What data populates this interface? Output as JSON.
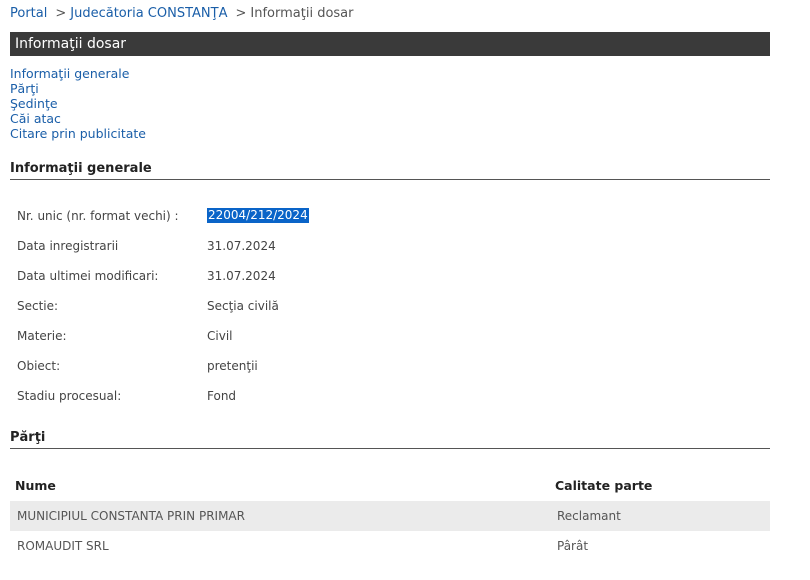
{
  "breadcrumb": {
    "items": [
      "Portal",
      "Judecătoria CONSTANŢA",
      "Informaţii dosar"
    ],
    "separator": ">"
  },
  "title": "Informaţii dosar",
  "nav": {
    "links": [
      "Informaţii generale",
      "Părţi",
      "Şedinţe",
      "Căi atac",
      "Citare prin publicitate"
    ]
  },
  "general": {
    "heading": "Informaţii generale",
    "rows": [
      {
        "label": "Nr. unic (nr. format vechi) :",
        "value": "22004/212/2024"
      },
      {
        "label": "Data inregistrarii",
        "value": "31.07.2024"
      },
      {
        "label": "Data ultimei modificari:",
        "value": "31.07.2024"
      },
      {
        "label": "Sectie:",
        "value": "Secţia civilă"
      },
      {
        "label": "Materie:",
        "value": "Civil"
      },
      {
        "label": "Obiect:",
        "value": "pretenţii"
      },
      {
        "label": "Stadiu procesual:",
        "value": "Fond"
      }
    ]
  },
  "parties": {
    "heading": "Părţi",
    "columns": [
      "Nume",
      "Calitate parte"
    ],
    "rows": [
      {
        "name": "MUNICIPIUL CONSTANTA PRIN PRIMAR",
        "role": "Reclamant"
      },
      {
        "name": "ROMAUDIT SRL",
        "role": "Pârât"
      }
    ]
  },
  "colors": {
    "link": "#1a5ea8",
    "title_bar": "#3a3a3a",
    "selection": "#0a64c8",
    "row_alt": "#ebebeb"
  }
}
